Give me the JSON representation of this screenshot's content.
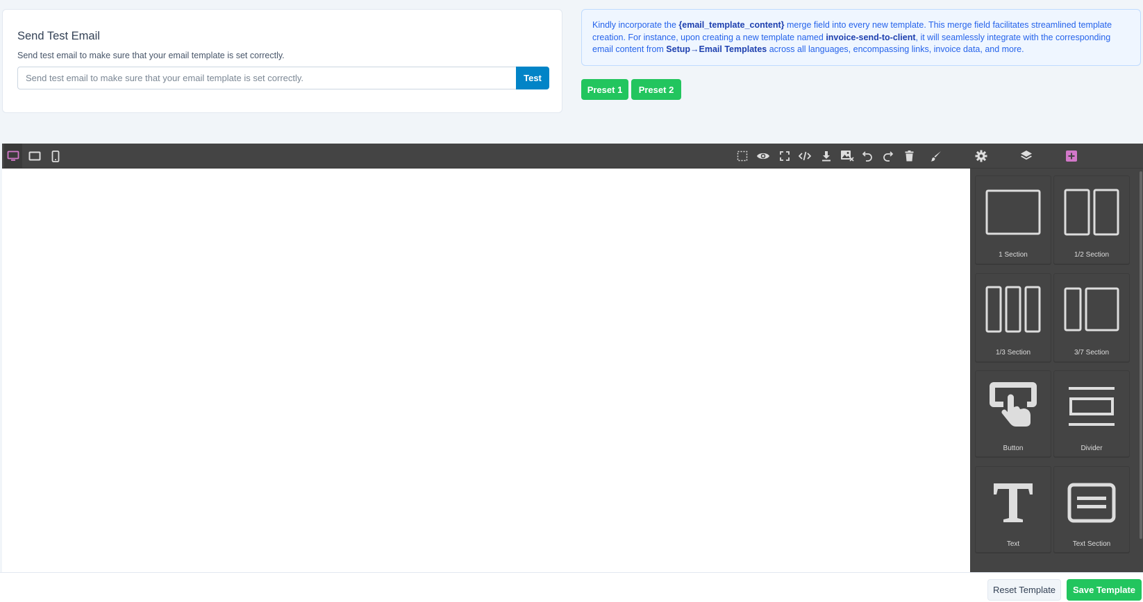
{
  "test_email": {
    "title": "Send Test Email",
    "description": "Send test email to make sure that your email template is set correctly.",
    "input_placeholder": "Send test email to make sure that your email template is set correctly.",
    "input_value": "",
    "test_label": "Test"
  },
  "info": {
    "t1": "Kindly incorporate the ",
    "b1": "{email_template_content}",
    "t2": " merge field into every new template. This merge field facilitates streamlined template creation. For instance, upon creating a new template named ",
    "b2": "invoice-send-to-client",
    "t3": ", it will seamlessly integrate with the corresponding email content from ",
    "b3": "Setup→Email Templates",
    "t4": " across all languages, encompassing links, invoice data, and more."
  },
  "presets": [
    "Preset 1",
    "Preset 2"
  ],
  "editor": {
    "devices": [
      "desktop-icon",
      "tablet-icon",
      "mobile-icon"
    ],
    "actions": [
      "select-area-icon",
      "eye-icon",
      "fullscreen-icon",
      "code-icon",
      "download-icon",
      "remove-image-icon",
      "undo-icon",
      "redo-icon",
      "trash-icon"
    ],
    "panel_tabs": [
      "paint-brush-icon",
      "gear-icon",
      "layers-icon",
      "add-block-icon"
    ],
    "accent_color": "#d278c9",
    "blocks": [
      {
        "label": "1 Section"
      },
      {
        "label": "1/2 Section"
      },
      {
        "label": "1/3 Section"
      },
      {
        "label": "3/7 Section"
      },
      {
        "label": "Button"
      },
      {
        "label": "Divider"
      },
      {
        "label": "Text"
      },
      {
        "label": "Text Section"
      }
    ]
  },
  "footer": {
    "reset_label": "Reset Template",
    "save_label": "Save Template"
  },
  "colors": {
    "primary": "#0284c7",
    "success": "#22c55e",
    "info_text": "#2563eb",
    "editor_bg": "#444444"
  }
}
